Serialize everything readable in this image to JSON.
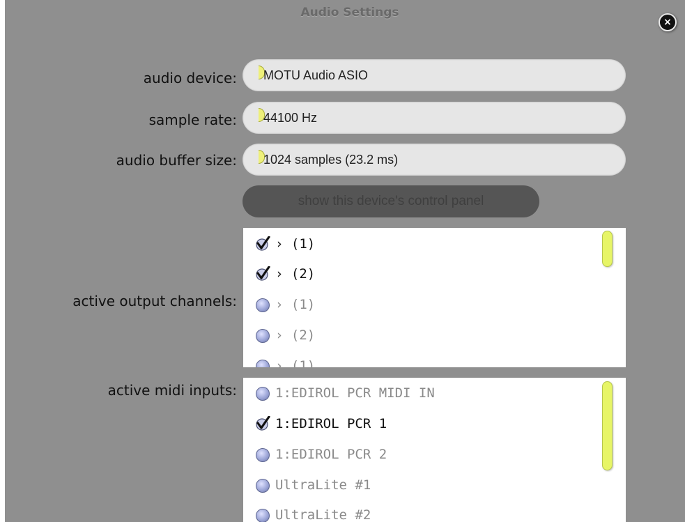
{
  "dialog": {
    "title": "Audio Settings",
    "close_glyph": "×"
  },
  "audio_device": {
    "label": "audio device:",
    "value": "MOTU Audio ASIO"
  },
  "sample_rate": {
    "label": "sample rate:",
    "value": "44100 Hz"
  },
  "buffer_size": {
    "label": "audio buffer size:",
    "value": "1024 samples (23.2 ms)"
  },
  "control_panel_button": {
    "label": "show this device's control panel"
  },
  "output_channels": {
    "label": "active output channels:",
    "items": [
      {
        "label": "› (1)",
        "checked": true
      },
      {
        "label": "› (2)",
        "checked": true
      },
      {
        "label": "› (1)",
        "checked": false
      },
      {
        "label": "› (2)",
        "checked": false
      },
      {
        "label": "› (1)",
        "checked": false
      }
    ]
  },
  "midi_inputs": {
    "label": "active midi inputs:",
    "items": [
      {
        "label": "1:EDIROL PCR MIDI IN",
        "checked": false
      },
      {
        "label": "1:EDIROL PCR 1",
        "checked": true
      },
      {
        "label": "1:EDIROL PCR 2",
        "checked": false
      },
      {
        "label": "UltraLite #1",
        "checked": false
      },
      {
        "label": "UltraLite #2",
        "checked": false
      }
    ]
  },
  "colors": {
    "panel_background": "#8f8f8f",
    "combo_background": "#e6e6e6",
    "accent_yellow": "#e7f567",
    "button_dark": "#555555"
  },
  "icons": {
    "checked": "checkmark-icon",
    "unchecked": "radio-icon",
    "close": "close-icon",
    "dropdown": "dropdown-arrow-icon"
  }
}
